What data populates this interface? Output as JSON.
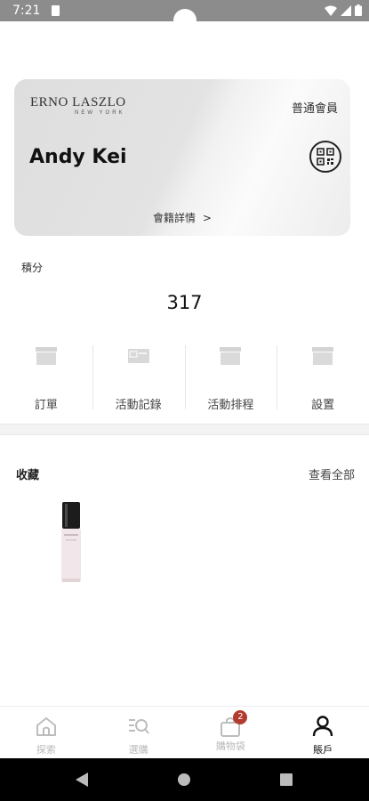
{
  "status_bar": {
    "time": "7:21"
  },
  "card": {
    "brand_name": "ERNO LASZLO",
    "brand_sub": "NEW YORK",
    "member_level": "普通會員",
    "member_name": "Andy Kei",
    "details_label": "會籍詳情",
    "details_chevron": ">"
  },
  "points": {
    "label": "積分",
    "value": "317"
  },
  "shortcuts": [
    {
      "label": "訂單",
      "icon": "box-icon"
    },
    {
      "label": "活動記錄",
      "icon": "card-icon"
    },
    {
      "label": "活動排程",
      "icon": "box-icon"
    },
    {
      "label": "設置",
      "icon": "box-icon"
    }
  ],
  "favourites": {
    "title": "收藏",
    "view_all": "查看全部"
  },
  "bottom_nav": {
    "items": [
      {
        "label": "探索",
        "icon": "home-icon"
      },
      {
        "label": "選購",
        "icon": "search-menu-icon"
      },
      {
        "label": "購物袋",
        "icon": "shopping-bag-icon",
        "badge": "2"
      },
      {
        "label": "賬戶",
        "icon": "account-icon",
        "active": true
      }
    ]
  },
  "colors": {
    "badge": "#b23a2e",
    "status_bar": "#8c8c8c",
    "nav_inactive": "#b9b9b9"
  }
}
